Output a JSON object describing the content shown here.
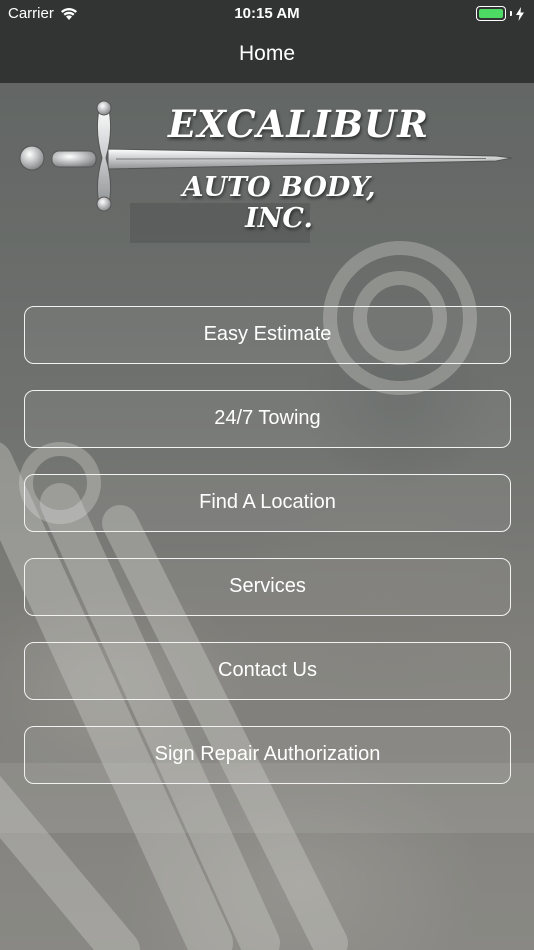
{
  "status_bar": {
    "carrier": "Carrier",
    "time": "10:15 AM",
    "wifi_icon": "wifi-icon",
    "battery_icon": "battery-icon",
    "charging_icon": "bolt-icon",
    "battery_color": "#4cd964",
    "battery_level": 1.0
  },
  "nav": {
    "title": "Home"
  },
  "logo": {
    "line1": "EXCALIBUR",
    "line2": "AUTO BODY, INC.",
    "icon": "sword-icon"
  },
  "menu": [
    {
      "label": "Easy Estimate"
    },
    {
      "label": "24/7 Towing"
    },
    {
      "label": "Find A Location"
    },
    {
      "label": "Services"
    },
    {
      "label": "Contact Us"
    },
    {
      "label": "Sign Repair Authorization"
    }
  ],
  "colors": {
    "bar_background": "#323433",
    "button_border": "#f2f2f2",
    "text": "#ffffff"
  }
}
